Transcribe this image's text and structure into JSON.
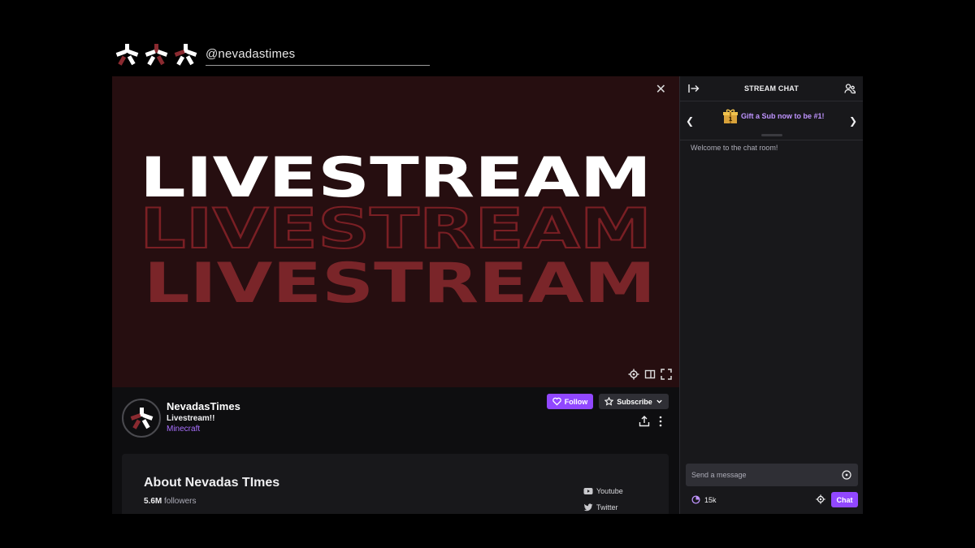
{
  "header": {
    "handle": "@nevadastimes"
  },
  "player": {
    "livestream_text": "LIVESTREAM",
    "bg_color": "#260e10",
    "outline_color": "#7a1f24",
    "fill2_color": "#7a2529"
  },
  "channel": {
    "name": "NevadasTimes",
    "stream_title": "Livestream!!",
    "game": "Minecraft",
    "follow_label": "Follow",
    "subscribe_label": "Subscribe"
  },
  "about": {
    "title": "About Nevadas TImes",
    "followers_count": "5.6M",
    "followers_label": "followers",
    "socials": [
      {
        "label": "Youtube",
        "icon": "youtube-icon"
      },
      {
        "label": "Twitter",
        "icon": "twitter-icon"
      }
    ]
  },
  "chat": {
    "title": "STREAM CHAT",
    "gift_text": "Gift a Sub now to be #1!",
    "welcome": "Welcome to the chat room!",
    "input_placeholder": "Send a message",
    "points": "15k",
    "chat_button": "Chat"
  },
  "colors": {
    "accent": "#9147ff",
    "accent_text": "#a970ff",
    "brand_white": "#ffffff",
    "brand_red": "#8a2a30"
  }
}
